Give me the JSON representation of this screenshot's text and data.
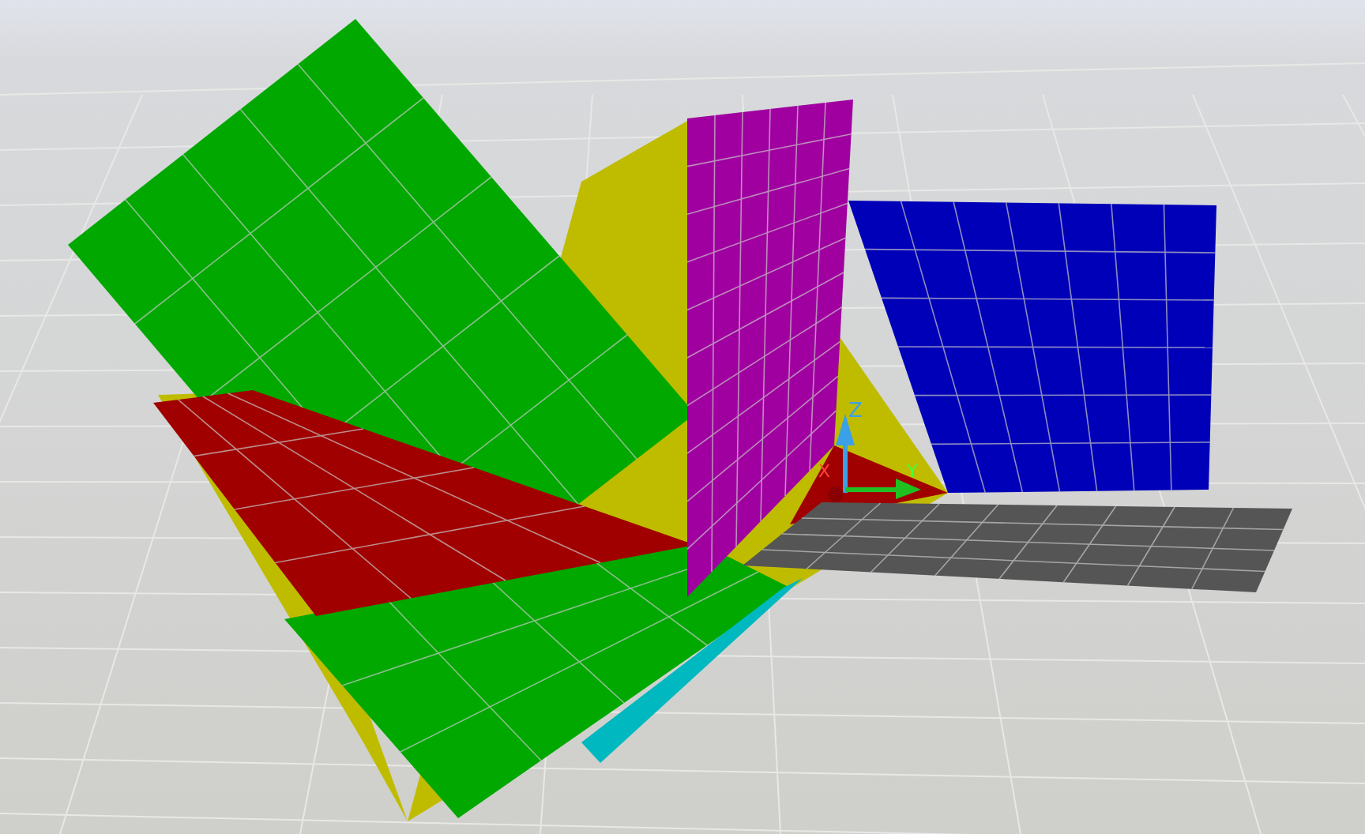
{
  "viewport": {
    "axes": [
      {
        "label": "Z"
      },
      {
        "label": "X"
      },
      {
        "label": "Y"
      }
    ]
  }
}
